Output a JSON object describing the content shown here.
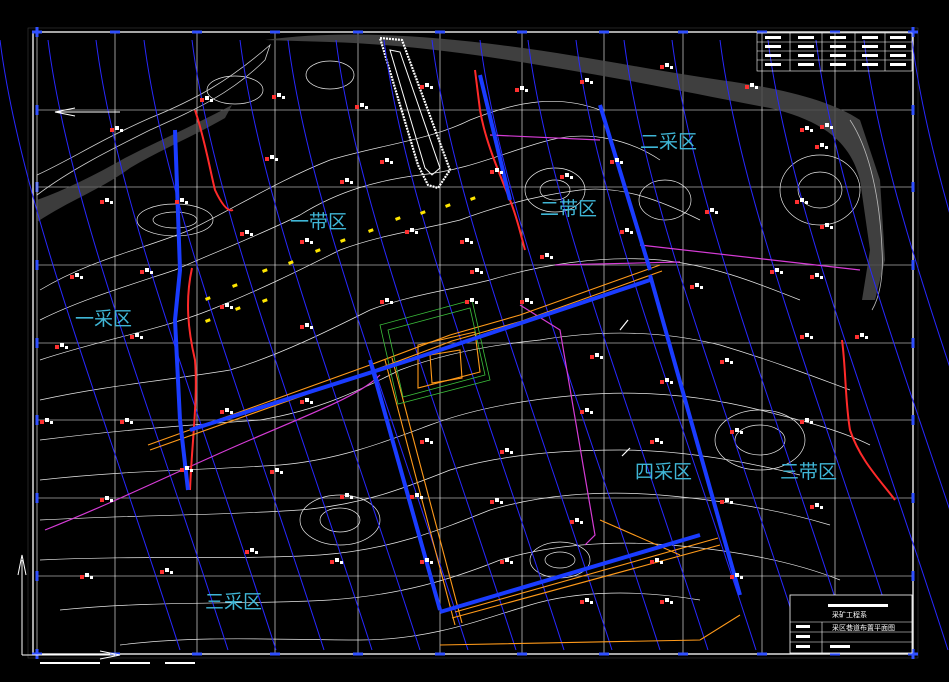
{
  "drawing": {
    "zones": [
      {
        "id": "band-1",
        "label": "一带区"
      },
      {
        "id": "band-2",
        "label": "二带区"
      },
      {
        "id": "band-3",
        "label": "三带区"
      },
      {
        "id": "mining-1",
        "label": "一采区"
      },
      {
        "id": "mining-2",
        "label": "二采区"
      },
      {
        "id": "mining-3",
        "label": "三采区"
      },
      {
        "id": "mining-4",
        "label": "四采区"
      }
    ],
    "title_block": {
      "header": "采矿工程系",
      "drawing_title": "采区巷道布置平面图"
    },
    "colors": {
      "background": "#000000",
      "grid": "#ffffff",
      "contour": "#e8e8e8",
      "seam_lines": "#2828ff",
      "roadway": "#ff9a1a",
      "boundary": "#d63cd6",
      "fault": "#ff2a2a",
      "zone_text": "#3fb6d6",
      "markers_yellow": "#ffe600",
      "frame_ticks": "#3050ff"
    }
  }
}
